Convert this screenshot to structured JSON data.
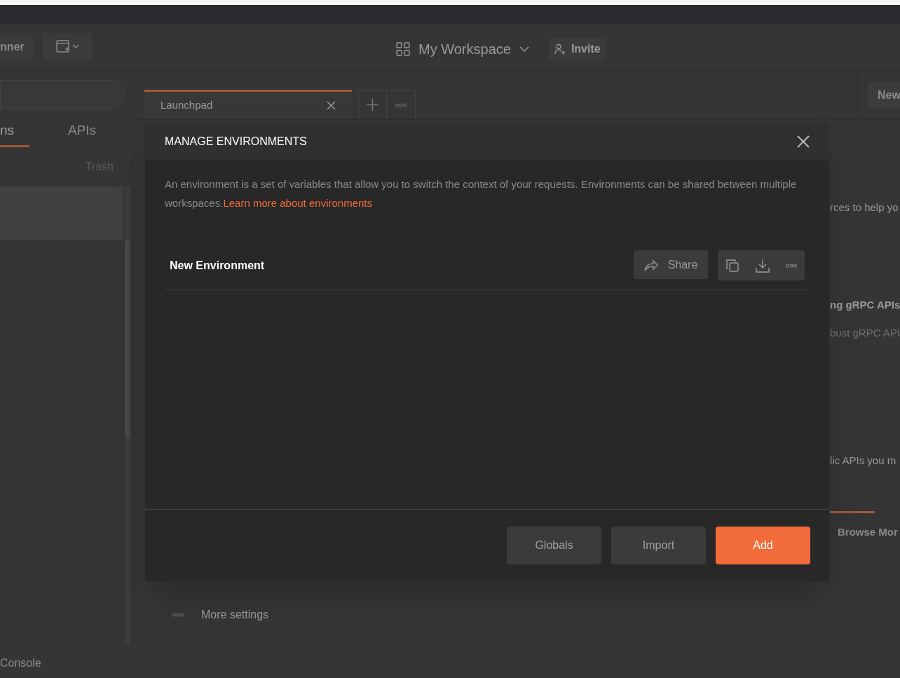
{
  "header": {
    "runner_label": "nner",
    "workspace": "My Workspace",
    "invite": "Invite"
  },
  "sidebar": {
    "tabs": [
      {
        "label": "ns",
        "selected": true
      },
      {
        "label": "APIs",
        "selected": false
      }
    ],
    "trash": "Trash"
  },
  "tabs": [
    {
      "label": "Launchpad",
      "selected": true
    }
  ],
  "new_button": "New",
  "launchpad": {
    "lines": [
      {
        "text": "rces to help yo",
        "kind": "plain"
      },
      {
        "text": "ng gRPC APIs",
        "kind": "bold"
      },
      {
        "text": "bust gRPC API",
        "kind": "muted"
      },
      {
        "text": "lic APIs you m",
        "kind": "plain"
      }
    ],
    "browse": "Browse Mor",
    "more_settings": "More settings"
  },
  "status_bar": {
    "console": "Console"
  },
  "modal": {
    "title": "MANAGE ENVIRONMENTS",
    "description": "An environment is a set of variables that allow you to switch the context of your requests. Environments can be shared between multiple workspaces.",
    "link": "Learn more about environments",
    "environments": [
      {
        "name": "New Environment"
      }
    ],
    "share": "Share",
    "buttons": [
      {
        "label": "Globals",
        "kind": "secondary"
      },
      {
        "label": "Import",
        "kind": "secondary"
      },
      {
        "label": "Add",
        "kind": "primary"
      }
    ]
  }
}
